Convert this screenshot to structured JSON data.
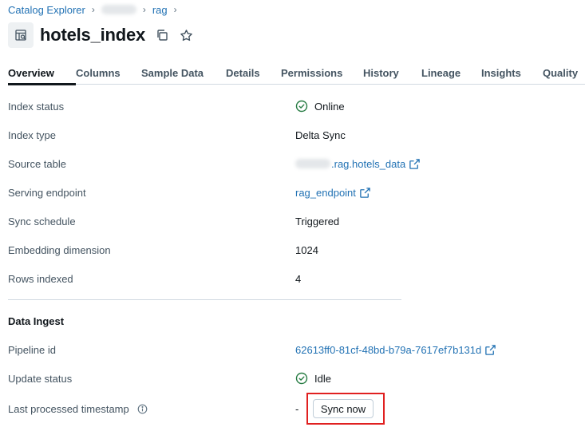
{
  "breadcrumb": {
    "root": "Catalog Explorer",
    "schema": "rag"
  },
  "page": {
    "title": "hotels_index"
  },
  "tabs": [
    {
      "label": "Overview",
      "active": true
    },
    {
      "label": "Columns"
    },
    {
      "label": "Sample Data"
    },
    {
      "label": "Details"
    },
    {
      "label": "Permissions"
    },
    {
      "label": "History"
    },
    {
      "label": "Lineage"
    },
    {
      "label": "Insights"
    },
    {
      "label": "Quality"
    }
  ],
  "overview": {
    "index_status": {
      "label": "Index status",
      "value": "Online"
    },
    "index_type": {
      "label": "Index type",
      "value": "Delta Sync"
    },
    "source_table": {
      "label": "Source table",
      "value": ".rag.hotels_data"
    },
    "serving_endpoint": {
      "label": "Serving endpoint",
      "value": "rag_endpoint"
    },
    "sync_schedule": {
      "label": "Sync schedule",
      "value": "Triggered"
    },
    "embedding_dimension": {
      "label": "Embedding dimension",
      "value": "1024"
    },
    "rows_indexed": {
      "label": "Rows indexed",
      "value": "4"
    }
  },
  "data_ingest": {
    "title": "Data Ingest",
    "pipeline_id": {
      "label": "Pipeline id",
      "value": "62613ff0-81cf-48bd-b79a-7617ef7b131d"
    },
    "update_status": {
      "label": "Update status",
      "value": "Idle"
    },
    "last_processed": {
      "label": "Last processed timestamp",
      "value": "-"
    },
    "sync_button": "Sync now"
  },
  "colors": {
    "link": "#2272b4",
    "success": "#277c43",
    "highlight": "#e02020"
  }
}
